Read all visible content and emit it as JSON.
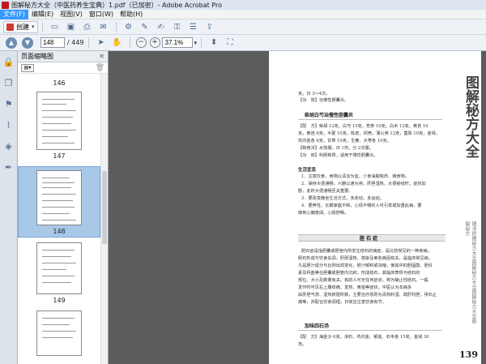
{
  "window": {
    "title": "图解秘方大全（中医药养生宝典）1.pdf（已加密）- Adobe Acrobat Pro"
  },
  "menu": [
    "文件(F)",
    "编辑(E)",
    "视图(V)",
    "窗口(W)",
    "帮助(H)"
  ],
  "toolbar": {
    "create_label": "创建"
  },
  "navigation": {
    "current_page": "148",
    "total_pages": "/ 449",
    "zoom": "37.1%"
  },
  "pane": {
    "title": "页面缩略图",
    "thumbnails": [
      {
        "label": "146"
      },
      {
        "label": "147"
      },
      {
        "label": "148",
        "selected": true
      },
      {
        "label": "149"
      }
    ]
  },
  "document": {
    "top_lines": [
      "克，日 3～4次。",
      "【功　效】治慢性胆囊炎。"
    ],
    "recipe1_title": "柴胡白芍治慢性胆囊炎",
    "recipe1_lines": [
      "【配　方】柴胡 12克，白芍 15克，党参 10克，白术 12克，黄芪 10",
      "克，黄连 6克，半夏 10克，陈皮，枳壳，蒲公英 12克，茵陈 10克，金钱，",
      "鸡内金各 6克，甘草 10克，生姜、大枣各 10克。",
      "【制用法】水煎服，日 1剂，分 2次服。",
      "【功　效】利胆和胃，适用于慢性胆囊炎。"
    ],
    "tips_title": "生活宜忌",
    "tips_lines": [
      "1．注意饮食，食物以清淡为宜，少食油腻和炸、烤食物。",
      "2．保持大便通畅，六腑以通为用，肝胆湿热，大便秘结时，症状加",
      "剧，此时大便通畅至关重要。",
      "3．要改变静坐生活方式，多走动，多运动。",
      "4．要养性，长期家庭不和，心情不畅的人可引发或加重此病，要",
      "做到心胸宽阔、心情舒畅。"
    ],
    "section_title": "胆 石 症",
    "section_lines": [
      "胆石症是指胆囊或胆管内所发生结石的病症，是比较常见的一种疾病。",
      "胆石形成与饮食失调、肝胆湿热、感染及某些病因有关，是临床常见病，",
      "凡是胆汁成分与比例出现变化，胆汁郁积或浓缩，使其中的胆固醇、胆红",
      "素及钙盐等在胆囊或胆管内沉积，形成结石，其临床表现与结石的",
      "部位、大小及数量有关。有的人可无任何症状，称为静止性结石。一般",
      "发作时可见右上腹绞痛、发热、黄疸等症状。中医认为本病多",
      "由肝胆气滞、湿热瘀阻所致，主要治疗原则为清热利湿、疏肝利胆、排石止",
      "痛等，并配合饮食调理，日常应注意饮食有节。"
    ],
    "recipe2_title": "加味四石汤",
    "recipe2_lines": [
      "【配　方】海金沙 6克，滑石、鸡内金、郁金、石韦各 15克，金钱 30",
      "克。"
    ],
    "side_title": "图解秘方大全",
    "side_deco": "随书附赠秘方大全图解秘方大全图解秘方大全图解秘方",
    "page_number": "139"
  }
}
